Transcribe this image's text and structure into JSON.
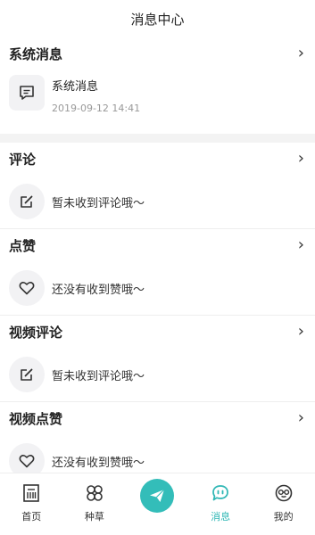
{
  "header": {
    "title": "消息中心"
  },
  "sections": {
    "system": {
      "title": "系统消息",
      "item_title": "系统消息",
      "item_time": "2019-09-12 14:41"
    },
    "comment": {
      "title": "评论",
      "empty": "暂未收到评论哦～"
    },
    "like": {
      "title": "点赞",
      "empty": "还没有收到赞哦～"
    },
    "video_comment": {
      "title": "视频评论",
      "empty": "暂未收到评论哦～"
    },
    "video_like": {
      "title": "视频点赞",
      "empty": "还没有收到赞哦～"
    }
  },
  "tabbar": {
    "home": "首页",
    "grass": "种草",
    "messages": "消息",
    "mine": "我的"
  },
  "colors": {
    "accent": "#2fb7b5",
    "center_button": "#33bdb9"
  }
}
